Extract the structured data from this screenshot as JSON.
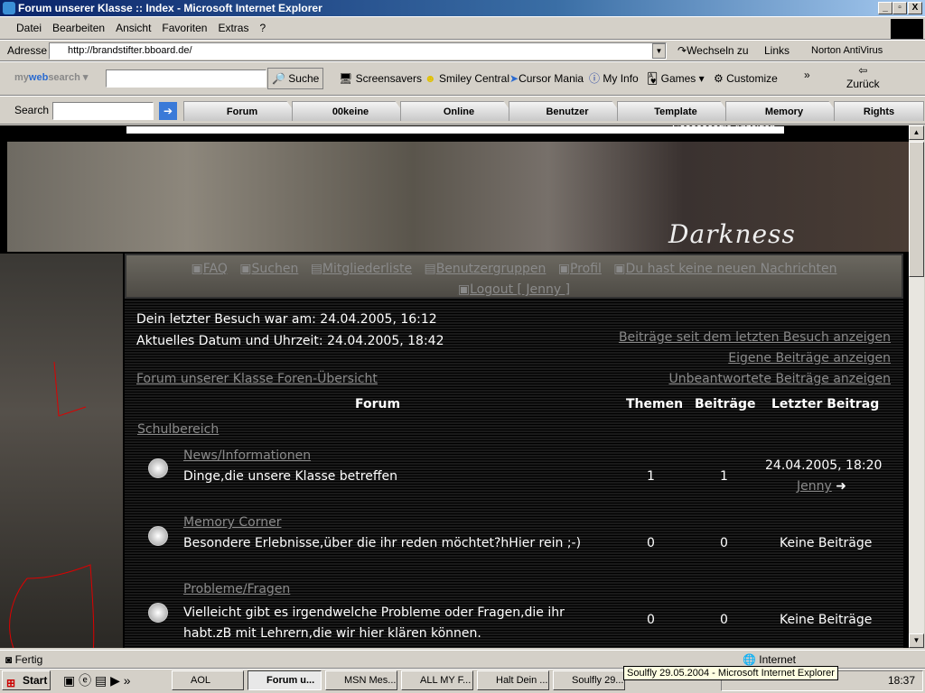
{
  "window": {
    "title": "Forum unserer Klasse :: Index - Microsoft Internet Explorer",
    "min": "_",
    "max": "▫",
    "close": "X"
  },
  "menu": [
    "Datei",
    "Bearbeiten",
    "Ansicht",
    "Favoriten",
    "Extras",
    "?"
  ],
  "address": {
    "label": "Adresse",
    "url": "http://brandstifter.bboard.de/",
    "go": "Wechseln zu",
    "links": "Links",
    "norton": "Norton AntiVirus"
  },
  "mywebsearch": {
    "logo_my": "my",
    "logo_web": "web",
    "logo_search": "search",
    "search_btn": "Suche",
    "items": [
      "Screensavers",
      "Smiley Central",
      "Cursor Mania",
      "My Info",
      "Games",
      "Customize"
    ],
    "back": "Zurück"
  },
  "searchbar": {
    "label": "Search",
    "tabs": [
      "Forum",
      "00keine",
      "Online",
      "Benutzer",
      "Template",
      "Memory",
      "Rights"
    ]
  },
  "page": {
    "ads": "Gooooooogle Anzeigen",
    "logo": "DARKNESS",
    "nav": [
      "FAQ",
      "Suchen",
      "Mitgliederliste",
      "Benutzergruppen",
      "Profil",
      "Du hast keine neuen Nachrichten",
      "Logout [ Jenny ]"
    ],
    "last_visit": "Dein letzter Besuch war am: 24.04.2005, 16:12",
    "current_time": "Aktuelles Datum und Uhrzeit: 24.04.2005, 18:42",
    "links": [
      "Beiträge seit dem letzten Besuch anzeigen",
      "Eigene Beiträge anzeigen",
      "Unbeantwortete Beiträge anzeigen"
    ],
    "index_link": "Forum unserer Klasse Foren-Übersicht",
    "headers": {
      "forum": "Forum",
      "topics": "Themen",
      "posts": "Beiträge",
      "last": "Letzter Beitrag"
    },
    "category": "Schulbereich",
    "forums": [
      {
        "name": "News/Informationen",
        "desc": "Dinge,die unsere Klasse betreffen",
        "topics": "1",
        "posts": "1",
        "last_date": "24.04.2005, 18:20",
        "last_user": "Jenny"
      },
      {
        "name": "Memory Corner",
        "desc": "Besondere Erlebnisse,über die ihr reden möchtet?hHier rein ;-)",
        "topics": "0",
        "posts": "0",
        "last": "Keine Beiträge"
      },
      {
        "name": "Probleme/Fragen",
        "desc": "Vielleicht gibt es irgendwelche Probleme oder Fragen,die ihr habt.zB mit Lehrern,die wir hier klären können.",
        "topics": "0",
        "posts": "0",
        "last": "Keine Beiträge"
      }
    ]
  },
  "status": {
    "text": "Fertig",
    "zone": "Internet"
  },
  "taskbar": {
    "start": "Start",
    "buttons": [
      "AOL",
      "Forum u...",
      "MSN Mes...",
      "ALL MY F...",
      "Halt Dein ...",
      "Soulfly 29...."
    ],
    "tooltip": "Soulfly 29.05.2004 - Microsoft Internet Explorer",
    "clock": "18:37"
  },
  "colors": {
    "title": "#0a246a",
    "link": "#8a8a8a"
  }
}
